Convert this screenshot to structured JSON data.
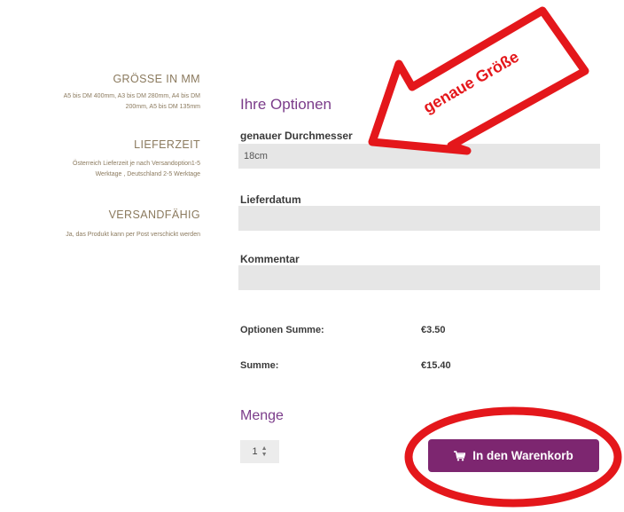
{
  "specs": [
    {
      "title": "GRÖSSE IN MM",
      "text": [
        "A5 bis DM 400mm, A3 bis DM 280mm, A4 bis DM",
        "200mm, A5 bis DM 135mm"
      ]
    },
    {
      "title": "LIEFERZEIT",
      "text": [
        "Österreich Lieferzeit je nach Versandoption1-5",
        "Werktage , Deutschland 2-5 Werktage"
      ]
    },
    {
      "title": "VERSANDFÄHIG",
      "text": [
        "Ja, das Produkt kann per Post verschickt werden"
      ]
    }
  ],
  "options": {
    "title": "Ihre Optionen",
    "fields": [
      {
        "label": "genauer Durchmesser",
        "value": "18cm",
        "placeholder": ""
      },
      {
        "label": "Lieferdatum",
        "value": "",
        "placeholder": ""
      },
      {
        "label": "Kommentar",
        "value": "",
        "placeholder": ""
      }
    ]
  },
  "summary": {
    "options_label": "Optionen Summe:",
    "options_value": "€3.50",
    "total_label": "Summe:",
    "total_value": "€15.40"
  },
  "quantity": {
    "label": "Menge",
    "value": "1"
  },
  "cart_button": {
    "label": "In den Warenkorb",
    "icon": "shopping-cart-icon"
  },
  "annotation": {
    "text": "genaue Größe",
    "color": "#e4171b"
  }
}
